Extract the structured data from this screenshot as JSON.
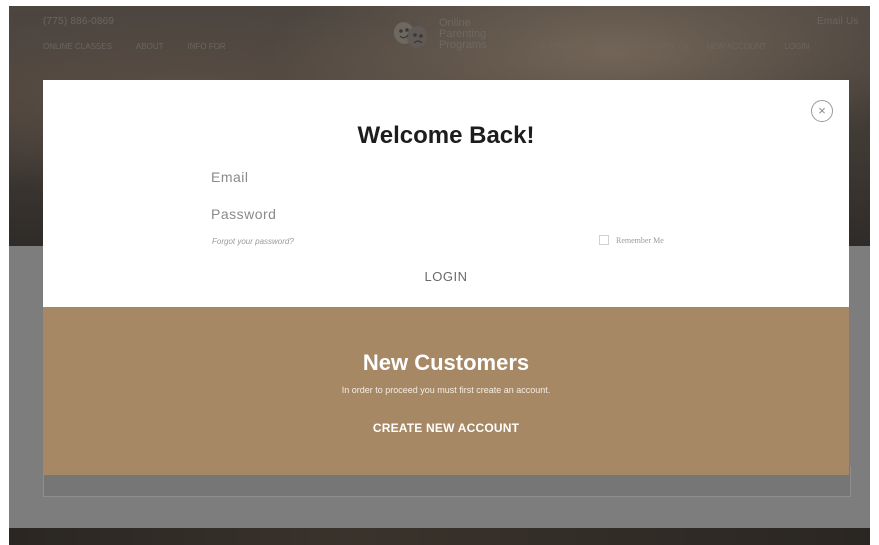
{
  "header": {
    "phone": "(775) 886-0869",
    "email_link": "Email Us",
    "nav_left": [
      "ONLINE CLASSES",
      "ABOUT",
      "INFO FOR"
    ],
    "logo": {
      "line1": "Online",
      "line2": "Parenting",
      "line3": "Programs"
    },
    "nav_right": {
      "support": "SUPPORT",
      "cart": "SHOPPING CART",
      "cart_count": "(0)",
      "new_account": "NEW ACCOUNT",
      "login": "LOGIN"
    }
  },
  "modal": {
    "close_glyph": "×",
    "login": {
      "title": "Welcome Back!",
      "email_placeholder": "Email",
      "password_placeholder": "Password",
      "forgot_link": "Forgot your password?",
      "remember_label": "Remember Me",
      "login_button": "LOGIN"
    },
    "new_customers": {
      "title": "New Customers",
      "subtitle": "In order to proceed you must first create an account.",
      "create_button": "CREATE NEW ACCOUNT"
    }
  },
  "colors": {
    "accent_tan": "#a78865",
    "overlay_gray": "#7d7d7d",
    "modal_white": "#ffffff"
  },
  "icons": [
    "theater-masks-logo-icon",
    "shopping-cart-icon",
    "close-icon"
  ]
}
